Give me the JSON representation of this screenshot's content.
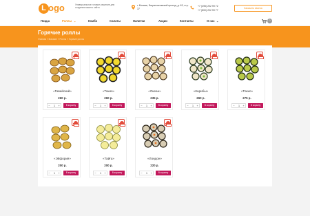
{
  "header": {
    "logo_letter": "L",
    "logo_text": "ogo",
    "tagline": "Универсальное готовое решение для создания вашего сайта",
    "address": "г. Москва, Багратионовский проезд, д. 63, стр. 37",
    "phones": [
      "+7 (495) 202 99 72",
      "+7 (800) 202 99 77"
    ],
    "callback_label": "Заказать звонок",
    "accent_color": "#f7941d"
  },
  "nav": {
    "items": [
      "Пицца",
      "Роллы",
      "Комбо",
      "Салаты",
      "Напитки",
      "Акции",
      "Контакты",
      "О нас"
    ],
    "active": "Роллы",
    "cart_count": "0"
  },
  "page": {
    "title": "Горячие роллы",
    "breadcrumb": "Главная  »  Магазин  »  Роллы  »  Горячие роллы"
  },
  "products": [
    {
      "name": "«Гавайский»",
      "price": "260 р.",
      "qty": "1",
      "sticker": true
    },
    {
      "name": "«Токио»",
      "price": "260 р.",
      "qty": "1",
      "sticker": true
    },
    {
      "name": "«Океан»",
      "price": "235 р.",
      "qty": "1",
      "sticker": true
    },
    {
      "name": "«Карибы»",
      "price": "260 р.",
      "qty": "1",
      "sticker": true
    },
    {
      "name": "«Токио»",
      "price": "275 р.",
      "qty": "1",
      "sticker": true
    },
    {
      "name": "«Эйфория»",
      "price": "200 р.",
      "qty": "1",
      "sticker": true
    },
    {
      "name": "«Тайга»",
      "price": "200 р.",
      "qty": "1",
      "sticker": true
    },
    {
      "name": "«Лондон»",
      "price": "220 р.",
      "qty": "1",
      "sticker": true
    }
  ],
  "labels": {
    "to_cart": "В корзину",
    "minus": "−",
    "plus": "+"
  },
  "icons": {
    "pin": "location-pin-icon",
    "phone": "phone-icon",
    "cart": "cart-icon",
    "dropdown": "chevron-down-icon"
  }
}
